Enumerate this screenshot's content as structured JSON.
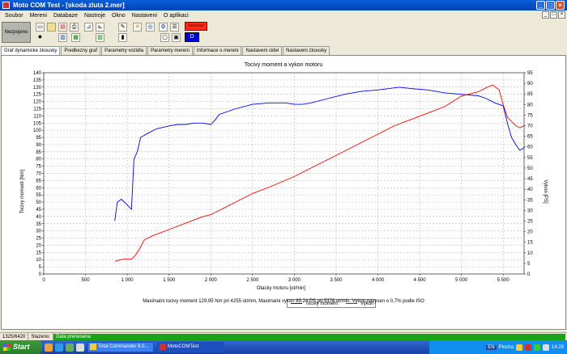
{
  "window": {
    "title": "Moto COM Test - [skoda zluta 2.mer]",
    "min": "_",
    "max": "□",
    "close": "×"
  },
  "menu": [
    "Soubor",
    "Mereni",
    "Databaze",
    "Nastroje",
    "Okno",
    "Nastaveni",
    "O aplikaci"
  ],
  "mdi": {
    "min": "_",
    "max": "□",
    "close": "×"
  },
  "toolbar": {
    "status": "Nezpojeno",
    "red_indicator": "Nulovani",
    "blue_indicator": "D"
  },
  "tabs": [
    "Graf dynamicke zkousky",
    "Predbezny graf",
    "Parametry vozidla",
    "Parametry mereni",
    "Informace o mereni",
    "Nastaveni cidel",
    "Nastaveni zkousky"
  ],
  "chart_data": {
    "type": "line",
    "title": "Tocivy moment a vykon motoru",
    "xlabel": "Otacky motoru [ot/min]",
    "ylabel_left": "Tocivy moment [Nm]",
    "ylabel_right": "Vykon [PS]",
    "xlim": [
      0,
      5750
    ],
    "ylim_left": [
      0,
      140
    ],
    "ylim_right": [
      0,
      95
    ],
    "x_ticks": [
      "0",
      "500",
      "1 000",
      "1 500",
      "2 000",
      "2 500",
      "3 000",
      "3 500",
      "4 000",
      "4 500",
      "5 000",
      "5 500"
    ],
    "x_tick_values": [
      0,
      500,
      1000,
      1500,
      2000,
      2500,
      3000,
      3500,
      4000,
      4500,
      5000,
      5500
    ],
    "y_left_ticks": [
      0,
      5,
      10,
      15,
      20,
      25,
      30,
      35,
      40,
      45,
      50,
      55,
      60,
      65,
      70,
      75,
      80,
      85,
      90,
      95,
      100,
      105,
      110,
      115,
      120,
      125,
      130,
      135,
      140
    ],
    "y_right_ticks": [
      0,
      5,
      10,
      15,
      20,
      25,
      30,
      35,
      40,
      45,
      50,
      55,
      60,
      65,
      70,
      75,
      80,
      85,
      90,
      95
    ],
    "grid": true,
    "legend_position": "bottom-center",
    "series": [
      {
        "name": "Tocivy moment",
        "axis": "left",
        "color": "#0000FF",
        "x": [
          850,
          880,
          930,
          1000,
          1050,
          1080,
          1120,
          1160,
          1250,
          1350,
          1500,
          1600,
          1700,
          1800,
          1900,
          2000,
          2050,
          2100,
          2300,
          2500,
          2700,
          2900,
          3000,
          3100,
          3200,
          3400,
          3600,
          3800,
          4000,
          4200,
          4255,
          4400,
          4600,
          4800,
          5000,
          5200,
          5300,
          5400,
          5500,
          5550,
          5600,
          5650,
          5700,
          5750
        ],
        "y": [
          37,
          50,
          52,
          48,
          45,
          80,
          85,
          95,
          98,
          101,
          103,
          104,
          104,
          105,
          105,
          104,
          107,
          111,
          115,
          118,
          119,
          119,
          118,
          118,
          119,
          122,
          125,
          127,
          128,
          129.5,
          129.95,
          129,
          128,
          126,
          125,
          124,
          122,
          119,
          117,
          105,
          95,
          90,
          86,
          88
        ]
      },
      {
        "name": "Vykon",
        "axis": "right",
        "color": "#FF0000",
        "x": [
          850,
          950,
          1050,
          1100,
          1150,
          1200,
          1300,
          1500,
          1700,
          1900,
          2000,
          2100,
          2300,
          2500,
          2700,
          3000,
          3200,
          3400,
          3600,
          3800,
          4000,
          4200,
          4400,
          4600,
          4800,
          5000,
          5200,
          5300,
          5376,
          5450,
          5500,
          5550,
          5600,
          5650,
          5700,
          5750
        ],
        "y": [
          6,
          7,
          7,
          9,
          12,
          16,
          18,
          21,
          24,
          27,
          28,
          30,
          34,
          38,
          41,
          46,
          50,
          54,
          58,
          62,
          66,
          70,
          73,
          76,
          79,
          84,
          86,
          88,
          89.24,
          87,
          80,
          74,
          72,
          70,
          69,
          70
        ]
      }
    ]
  },
  "summary": "Maximalni tocivy moment 129,95 Nm pri 4255 ot/min,  Maximalni vykon 89,24 PS pri 5376 ot/min,  Vykon navysen o 0,7% podle ISO",
  "statusbar": {
    "count": "1325/6420",
    "label": "Stazeno:",
    "progress_text": "Data prenesena",
    "progress": 1.0
  },
  "taskbar": {
    "start": "Start",
    "tasks": [
      {
        "label": "Total Commander 6.0...",
        "active": false
      },
      {
        "label": "MotoCOMTest",
        "active": true
      }
    ],
    "lang": "EN",
    "desktop": "Plocha",
    "clock": "14:29"
  }
}
